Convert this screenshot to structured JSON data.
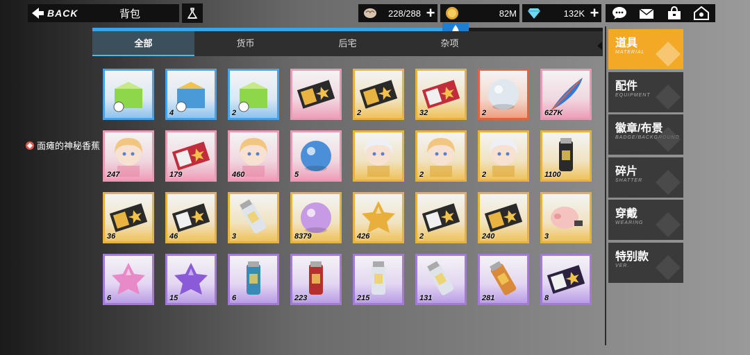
{
  "header": {
    "back_label": "BACK",
    "title": "背包",
    "resources": [
      {
        "icon": "brain-icon",
        "value": "228/288",
        "plus": "+"
      },
      {
        "icon": "coin-icon",
        "value": "82M"
      },
      {
        "icon": "diamond-icon",
        "value": "132K",
        "plus": "+"
      }
    ]
  },
  "tabs": [
    {
      "label": "全部",
      "active": true
    },
    {
      "label": "货币",
      "active": false
    },
    {
      "label": "后宅",
      "active": false
    },
    {
      "label": "杂项",
      "active": false
    }
  ],
  "owner_tip": "面瘫的神秘香蕉",
  "items": [
    {
      "name": "supply-box-green",
      "rarity": "blue",
      "count": ""
    },
    {
      "name": "gold-chest-timed",
      "rarity": "blue",
      "count": "4"
    },
    {
      "name": "green-chest-timed",
      "rarity": "blue",
      "count": "2"
    },
    {
      "name": "beta-ticket",
      "rarity": "pink",
      "count": ""
    },
    {
      "name": "alpha-ticket-gold",
      "rarity": "gold",
      "count": "2"
    },
    {
      "name": "alpha-ticket-red",
      "rarity": "gold",
      "count": "32"
    },
    {
      "name": "snow-globe",
      "rarity": "red",
      "count": "2"
    },
    {
      "name": "feather-quill",
      "rarity": "pink",
      "count": "627K"
    },
    {
      "name": "planet-ball-chibi",
      "rarity": "pink",
      "count": "247"
    },
    {
      "name": "pink-ticket-strip",
      "rarity": "pink",
      "count": "179"
    },
    {
      "name": "figure-story-chibi",
      "rarity": "pink",
      "count": "460"
    },
    {
      "name": "crystal-orb",
      "rarity": "pink",
      "count": "5"
    },
    {
      "name": "doll-portrait-silver",
      "rarity": "gold",
      "count": ""
    },
    {
      "name": "doll-portrait-blonde",
      "rarity": "gold",
      "count": "2"
    },
    {
      "name": "doll-portrait-white",
      "rarity": "gold",
      "count": "2"
    },
    {
      "name": "battery-canister",
      "rarity": "gold",
      "count": "1100"
    },
    {
      "name": "badge-scroll-gold",
      "rarity": "gold",
      "count": "36"
    },
    {
      "name": "magazine-book",
      "rarity": "gold",
      "count": "46"
    },
    {
      "name": "pen-tool",
      "rarity": "gold",
      "count": "3"
    },
    {
      "name": "glitter-orb",
      "rarity": "gold",
      "count": "8379"
    },
    {
      "name": "gold-star-coin",
      "rarity": "gold",
      "count": "426"
    },
    {
      "name": "black-ticket",
      "rarity": "gold",
      "count": "2"
    },
    {
      "name": "gold-card-cookies",
      "rarity": "gold",
      "count": "240"
    },
    {
      "name": "pig-usb",
      "rarity": "gold",
      "count": "3"
    },
    {
      "name": "pink-slime-star",
      "rarity": "purple",
      "count": "6"
    },
    {
      "name": "purple-gem",
      "rarity": "purple",
      "count": "15"
    },
    {
      "name": "blue-capsule",
      "rarity": "purple",
      "count": "6"
    },
    {
      "name": "red-capsule",
      "rarity": "purple",
      "count": "223"
    },
    {
      "name": "glue-bottle",
      "rarity": "purple",
      "count": "215"
    },
    {
      "name": "small-tube",
      "rarity": "purple",
      "count": "131"
    },
    {
      "name": "orange-tube",
      "rarity": "purple",
      "count": "281"
    },
    {
      "name": "badge-scroll-purple",
      "rarity": "purple",
      "count": "8"
    }
  ],
  "categories": [
    {
      "title": "道具",
      "sub": "MATERIAL",
      "active": true
    },
    {
      "title": "配件",
      "sub": "EQUIPMENT",
      "active": false
    },
    {
      "title": "徽章/布景",
      "sub": "BADGE/BACKGROUND",
      "active": false
    },
    {
      "title": "碎片",
      "sub": "SHATTER",
      "active": false
    },
    {
      "title": "穿戴",
      "sub": "WEARING",
      "active": false
    },
    {
      "title": "特别款",
      "sub": "VER.",
      "active": false
    }
  ],
  "colors": {
    "accent_blue": "#3aa5e0",
    "active_orange": "#f3a826",
    "panel_dark": "#111111"
  },
  "progress_fraction": 0.69
}
